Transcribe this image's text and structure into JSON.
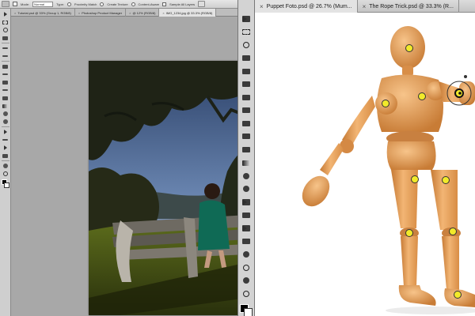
{
  "left_window": {
    "options": {
      "mode_label": "Mode:",
      "mode_value": "Normal",
      "type_label": "Type:",
      "type_options": [
        "Proximity Match",
        "Create Texture",
        "Content-Aware"
      ],
      "sample_all_label": "Sample All Layers"
    },
    "tabs": [
      {
        "label": "Tutorial.psd @ 33% (Group 1, RGB/8)",
        "active": false
      },
      {
        "label": "Photoshop Product Manager",
        "active": false
      },
      {
        "label": "@ 12% (RGB/8)",
        "active": false
      },
      {
        "label": "IMG_1234.jpg @ 33.3% (RGB/8)",
        "active": true
      }
    ]
  },
  "right_window": {
    "tabs": [
      {
        "label": "Puppet Foto.psd @ 26.7% (Mum...",
        "active": true
      },
      {
        "label": "The Rope Trick.psd @ 33.3% (R...",
        "active": false
      }
    ]
  },
  "icons": {
    "left_tools": [
      "move-icon",
      "marquee-icon",
      "lasso-icon",
      "quick-select-icon",
      "crop-icon",
      "eyedropper-icon",
      "spot-healing-icon",
      "brush-icon",
      "clone-stamp-icon",
      "history-brush-icon",
      "eraser-icon",
      "gradient-icon",
      "blur-icon",
      "dodge-icon",
      "pen-icon",
      "type-icon",
      "path-select-icon",
      "shape-icon",
      "hand-icon",
      "zoom-icon"
    ],
    "mid_tools": [
      "move-icon",
      "marquee-icon",
      "lasso-icon",
      "quick-select-icon",
      "crop-icon",
      "eyedropper-icon",
      "spot-healing-icon",
      "brush-icon",
      "clone-stamp-icon",
      "history-brush-icon",
      "eraser-icon",
      "gradient-icon",
      "blur-icon",
      "dodge-icon",
      "pen-icon",
      "type-icon",
      "path-select-icon",
      "shape-icon",
      "3d-rotate-icon",
      "3d-orbit-icon",
      "hand-icon",
      "zoom-icon"
    ]
  },
  "colors": {
    "puppet_pin": "#f2ea2a",
    "wood_light": "#f0b070",
    "wood_dark": "#c67a35",
    "ui_panel": "#cfcfcf"
  }
}
